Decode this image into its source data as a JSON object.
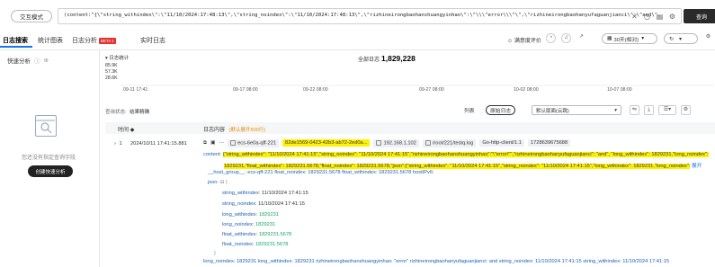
{
  "topbar": {
    "mode_button": "交互模式",
    "query": "(content:\"{\\\"string_withindex\\\":\\\"11/10/2024:17:48:13\\\",\\\"string_noindex\\\":\\\"11/10/2024:17:48:13\\\",\\\"rizhineirongbaohanshuangyinhao\\\":\\\"\\\\\\\"error\\\\\\\"\\\",\\\"rizhineirongbaohanyufaguanjianci\\\":\\\"and\\\",",
    "search_button": "查询"
  },
  "tabs": [
    {
      "label": "日志搜索",
      "active": true
    },
    {
      "label": "统计图表",
      "active": false
    },
    {
      "label": "日志分析",
      "active": false,
      "badge": "BETA 1"
    },
    {
      "label": "实时日志",
      "active": false
    }
  ],
  "controls": {
    "satisfaction": "满意度评价",
    "time_range": "30天(相对)",
    "refresh_icon": "refresh-icon"
  },
  "sidebar": {
    "title": "快速分析",
    "empty_text": "您还没有指定查询字段",
    "create_button": "创建快速分析"
  },
  "chart_data": {
    "type": "bar",
    "title": "日志统计",
    "total_label": "全部日志",
    "total_value": "1,829,228",
    "yticks": [
      "85.9K",
      "57.3K",
      "28.6K"
    ],
    "xticks": [
      "09-11 17:41",
      "09-17 08:00",
      "09-22 08:00",
      "09-27 08:00",
      "10-02 08:00",
      "10-07 08:00"
    ]
  },
  "table_toolbar": {
    "status_label": "查询状态:",
    "status_value": "结果精确",
    "view_list": "列表",
    "view_raw": "原始日志",
    "format_select": "默认版面(云跳)"
  },
  "table": {
    "col_time": "时间",
    "col_content": "日志内容",
    "col_content_hint": "(默认展开500行)",
    "row": {
      "index": "1",
      "time": "2024/10/11 17:41:15.881",
      "meta": {
        "host_tag": "ecs-6e0a-qff-221",
        "hash_tag": "82de1569-0423-42b3-ab72-2ed0a...",
        "ip": "192.168.1.102",
        "path": "/root/221/testq.log",
        "client": "Go-http-client/1.1",
        "ts": "1728639675688"
      },
      "content_label": "content:",
      "content_line1": "{\"string_withindex\": \"11/10/2024 17:41:15\",\"string_noindex\": \"11/10/2024 17:41:15\",\"rizhineirongbaohanshuangyinhao\":\"\\\"error\\\"\",\"rizhineirongbaohanyufaguanjianci\": \"and\", \"long_withindex\": 1829231,\"long_noindex\":",
      "content_line2": "1829231,\"float_withindex\": 1829231.5678,\"float_noindex\": 1829231.5678,\"json\":{\"string_withindex\": \"11/10/2024 17:41:15\",\"string_noindex\": \"11/10/2024 17:41:15\",\"long_withindex\": 1829231,\"long_noindex\":",
      "expand_link": "展开",
      "content_line3_prefix": "__host_group__:",
      "content_line3": "ecs-qff-221  float_noindex: 1829231.5678  float_withindex: 1829231.5678  hostIPv6:",
      "json_label": "json:",
      "json_fields": [
        {
          "key": "string_withindex",
          "value": "11/10/2024 17:41:15",
          "green": false
        },
        {
          "key": "string_noindex",
          "value": "11/10/2024 17:41:15",
          "green": false
        },
        {
          "key": "long_withindex",
          "value": "1829231",
          "green": true
        },
        {
          "key": "long_noindex",
          "value": "1829231",
          "green": true
        },
        {
          "key": "float_withindex",
          "value": "1829231.5678",
          "green": true
        },
        {
          "key": "float_noindex",
          "value": "1829231.5678",
          "green": true
        }
      ],
      "json_close": "}",
      "bottom_line": "long_noindex: 1829231  long_withindex: 1829231  rizhineirongbaohanshuangyinhao: \"error\"  rizhineirongbaohanyufaguanjianci: and  string_noindex: 11/10/2024 17:41:15  string_withindex: 11/10/2024 17:41:15"
    }
  }
}
